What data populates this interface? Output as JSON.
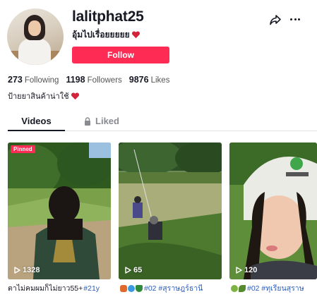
{
  "profile": {
    "username": "lalitphat25",
    "nickname": "อุ้มไปเรื่อยยยยย",
    "follow_label": "Follow",
    "bio": "ป้ายยาสินค้าน่าใช้"
  },
  "stats": [
    {
      "value": "273",
      "label": "Following"
    },
    {
      "value": "1198",
      "label": "Followers"
    },
    {
      "value": "9876",
      "label": "Likes"
    }
  ],
  "tabs": {
    "videos": "Videos",
    "liked": "Liked"
  },
  "videos": [
    {
      "pinned": "Pinned",
      "views": "1328",
      "caption_text": "ตาไม่คมผมก็ไม่ยาว55+",
      "caption_tag": "#21y"
    },
    {
      "views": "65",
      "caption_text": "",
      "caption_tag": "#02 #สุราษฎร์ธานี"
    },
    {
      "views": "120",
      "caption_text": "",
      "caption_tag": "#02 #ทุเรียนสุราษ"
    }
  ],
  "colors": {
    "accent": "#fe2c55",
    "hashtag": "#2b5db9",
    "muted": "#8a8b91"
  },
  "icons": [
    "share-icon",
    "more-icon",
    "lock-icon",
    "play-icon",
    "heart-emoji"
  ]
}
